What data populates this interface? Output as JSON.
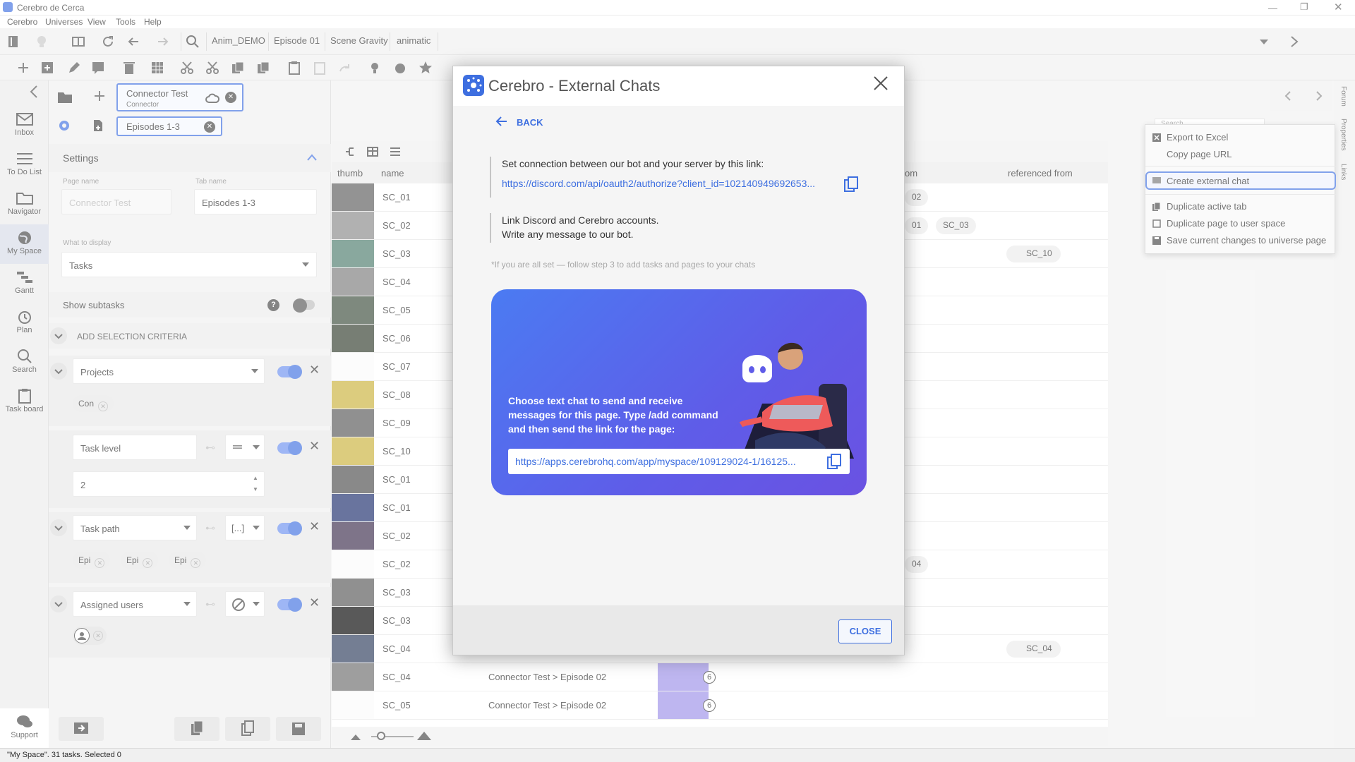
{
  "window": {
    "title": "Cerebro de Cerca"
  },
  "menu": [
    "Cerebro",
    "Universes",
    "View",
    "Tools",
    "Help"
  ],
  "breadcrumbs": [
    "Anim_DEMO",
    "Episode 01",
    "Scene Gravity",
    "animatic"
  ],
  "nav": [
    {
      "label": "Inbox",
      "icon": "mail-icon"
    },
    {
      "label": "To Do List",
      "icon": "list-icon"
    },
    {
      "label": "Navigator",
      "icon": "folder-icon"
    },
    {
      "label": "My Space",
      "icon": "globe-icon"
    },
    {
      "label": "Gantt",
      "icon": "gantt-icon"
    },
    {
      "label": "Plan",
      "icon": "clock-icon"
    },
    {
      "label": "Search",
      "icon": "search-icon"
    },
    {
      "label": "Task board",
      "icon": "clipboard-icon"
    },
    {
      "label": "Support",
      "icon": "chat-icon"
    }
  ],
  "tabs": {
    "connector": {
      "title": "Connector Test",
      "subtitle": "Connector"
    },
    "episodes": {
      "title": "Episodes 1-3"
    }
  },
  "settings": {
    "title": "Settings",
    "page_name_label": "Page name",
    "page_name_value": "Connector Test",
    "tab_name_label": "Tab name",
    "tab_name_value": "Episodes 1-3",
    "display_label": "What to display",
    "display_value": "Tasks",
    "show_subtasks": "Show subtasks",
    "add_criteria": "ADD SELECTION CRITERIA",
    "criteria": [
      {
        "field": "Projects",
        "tags": [
          "Con"
        ]
      },
      {
        "field": "Task level",
        "value": "2"
      },
      {
        "field": "Task path",
        "op": "[...]",
        "tags": [
          "Epi",
          "Epi",
          "Epi"
        ]
      },
      {
        "field": "Assigned users"
      }
    ]
  },
  "table": {
    "headers": [
      "thumb",
      "name",
      "om",
      "referenced from"
    ],
    "rows": [
      {
        "name": "SC_01",
        "ref_from": "",
        "refs": [
          "02"
        ]
      },
      {
        "name": "SC_02",
        "ref_from": "",
        "refs": [
          "01",
          "SC_03"
        ]
      },
      {
        "name": "SC_03",
        "ref_from": "SC_10",
        "refs": []
      },
      {
        "name": "SC_04",
        "ref_from": "",
        "refs": []
      },
      {
        "name": "SC_05",
        "ref_from": "",
        "refs": []
      },
      {
        "name": "SC_06",
        "ref_from": "",
        "refs": []
      },
      {
        "name": "SC_07",
        "ref_from": "",
        "refs": []
      },
      {
        "name": "SC_08",
        "ref_from": "",
        "refs": []
      },
      {
        "name": "SC_09",
        "ref_from": "",
        "refs": []
      },
      {
        "name": "SC_10",
        "ref_from": "",
        "refs": []
      },
      {
        "name": "SC_01",
        "ref_from": "",
        "refs": []
      },
      {
        "name": "SC_01",
        "ref_from": "",
        "refs": []
      },
      {
        "name": "SC_02",
        "ref_from": "",
        "refs": []
      },
      {
        "name": "SC_02",
        "ref_from": "",
        "refs": [
          "04"
        ]
      },
      {
        "name": "SC_03",
        "ref_from": "",
        "refs": []
      },
      {
        "name": "SC_03",
        "ref_from": "",
        "refs": []
      },
      {
        "name": "SC_04",
        "ref_from": "SC_04",
        "refs": []
      },
      {
        "name": "SC_04",
        "path": "Connector Test",
        "path2": "Episode 02",
        "count": "6",
        "ref_from": "",
        "refs": []
      },
      {
        "name": "SC_05",
        "path": "Connector Test",
        "path2": "Episode 02",
        "count": "6",
        "ref_from": "",
        "refs": []
      }
    ]
  },
  "context_menu": {
    "items": [
      "Export to Excel",
      "Copy page URL",
      "Create external chat",
      "Duplicate active tab",
      "Duplicate page to user space",
      "Save current changes to universe page"
    ],
    "search_placeholder": "Search"
  },
  "side_tabs": [
    "Forum",
    "Properties",
    "Links"
  ],
  "modal": {
    "title": "Cerebro - External Chats",
    "back": "BACK",
    "step1_text": "Set connection between our bot and your server by this link:",
    "step1_link": "https://discord.com/api/oauth2/authorize?client_id=102140949692653...",
    "step2_line1": "Link Discord and Cerebro accounts.",
    "step2_line2": "Write any message to our bot.",
    "hint": "*If you are all set — follow step 3 to add tasks and pages to your chats",
    "card_text": "Choose text chat to send and receive messages for this page. Type /add command and then send the link for the page:",
    "card_link": "https://apps.cerebrohq.com/app/myspace/109129024-1/16125...",
    "close": "CLOSE"
  },
  "status": "\"My Space\". 31 tasks. Selected 0",
  "colors": {
    "accent": "#3e6fe0",
    "card_grad_start": "#4a78f0",
    "card_grad_end": "#5b4fe0",
    "bar": "#9b8fe8",
    "bar_alt": "#c8b44a"
  }
}
